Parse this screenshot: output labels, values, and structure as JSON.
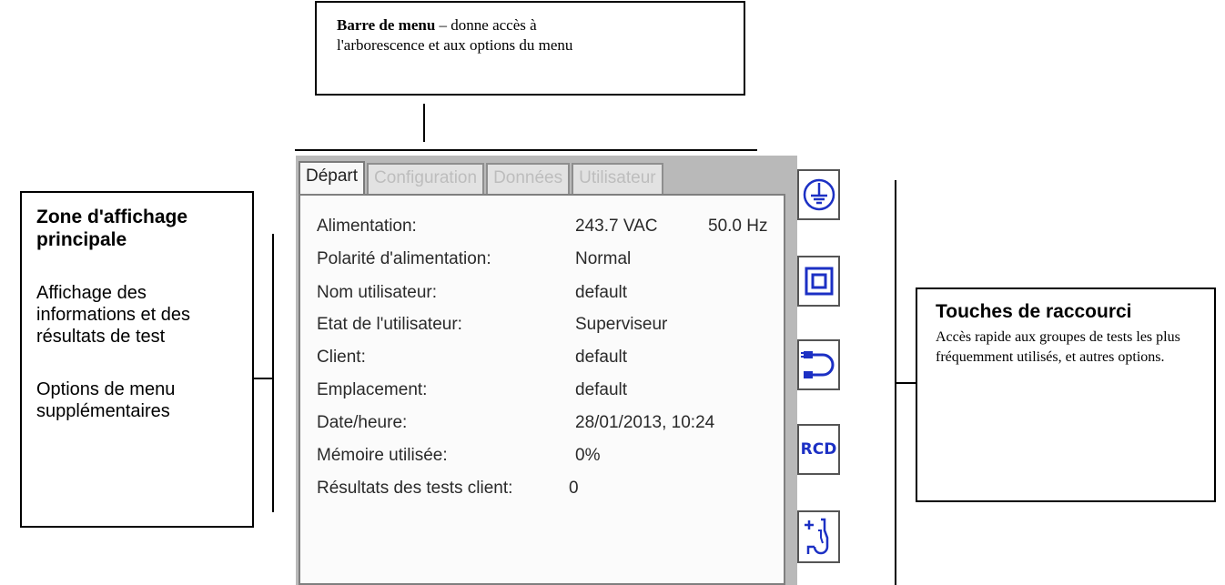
{
  "callouts": {
    "menu_bar": {
      "title": "Barre de menu",
      "text_after": " – donne accès à",
      "text_line2": "l'arborescence et aux options du menu"
    },
    "main_display": {
      "title": "Zone d'affichage principale",
      "p1": "Affichage des informations et des résultats de test",
      "p2": "Options de menu supplémentaires"
    },
    "shortcut_keys": {
      "title": "Touches de raccourci",
      "p1": "Accès rapide aux groupes de tests les plus fréquemment utilisés, et autres options."
    }
  },
  "tabs": [
    {
      "label": "Départ",
      "active": true
    },
    {
      "label": "Configuration",
      "active": false
    },
    {
      "label": "Données",
      "active": false
    },
    {
      "label": "Utilisateur",
      "active": false
    }
  ],
  "info": [
    {
      "label": "Alimentation:",
      "value": "243.7 VAC",
      "value2": "50.0 Hz"
    },
    {
      "label": "Polarité d'alimentation:",
      "value": "Normal"
    },
    {
      "label": "Nom utilisateur:",
      "value": "default"
    },
    {
      "label": "Etat de l'utilisateur:",
      "value": "Superviseur"
    },
    {
      "label": "Client:",
      "value": "default"
    },
    {
      "label": "Emplacement:",
      "value": "default"
    },
    {
      "label": "Date/heure:",
      "value": "28/01/2013, 10:24"
    },
    {
      "label": "Mémoire utilisée:",
      "value": "0%"
    },
    {
      "label": "Résultats des tests client:",
      "value": "0"
    }
  ],
  "shortcuts": [
    {
      "icon": "earth-ground-icon"
    },
    {
      "icon": "double-insulation-icon"
    },
    {
      "icon": "lead-cable-icon"
    },
    {
      "icon": "rcd-icon",
      "label": "RCD"
    },
    {
      "icon": "add-probe-icon"
    }
  ],
  "colors": {
    "icon_blue": "#1c30c4",
    "device_gray": "#b9b9b9"
  }
}
